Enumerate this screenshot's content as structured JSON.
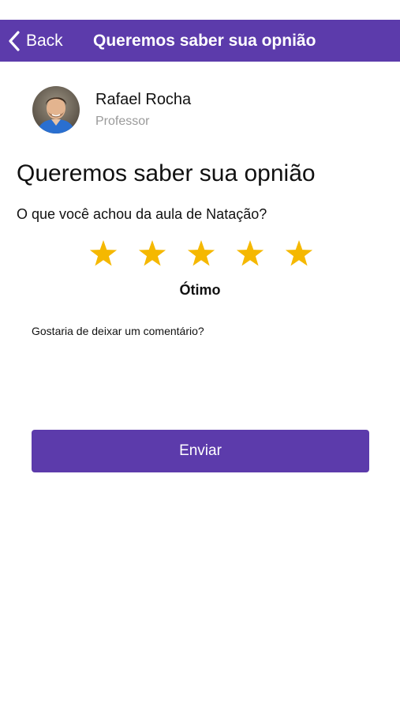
{
  "nav": {
    "back_label": "Back",
    "title": "Queremos saber sua opnião",
    "back_icon": "chevron-left-icon",
    "color": "#5c3bab"
  },
  "teacher": {
    "name": "Rafael Rocha",
    "role": "Professor",
    "avatar_icon": "avatar-photo"
  },
  "main": {
    "title": "Queremos saber sua opnião",
    "question": "O que você achou da aula de Natação?",
    "rating": {
      "value": 5,
      "max": 5,
      "label": "Ótimo",
      "star_color": "#f5b800",
      "star_icon": "star-icon"
    },
    "comment_label": "Gostaria de deixar um comentário?",
    "comment_value": "",
    "submit_label": "Enviar"
  },
  "colors": {
    "accent": "#5c3bab",
    "text": "#111111",
    "muted": "#9a9a9a",
    "background": "#ffffff"
  }
}
